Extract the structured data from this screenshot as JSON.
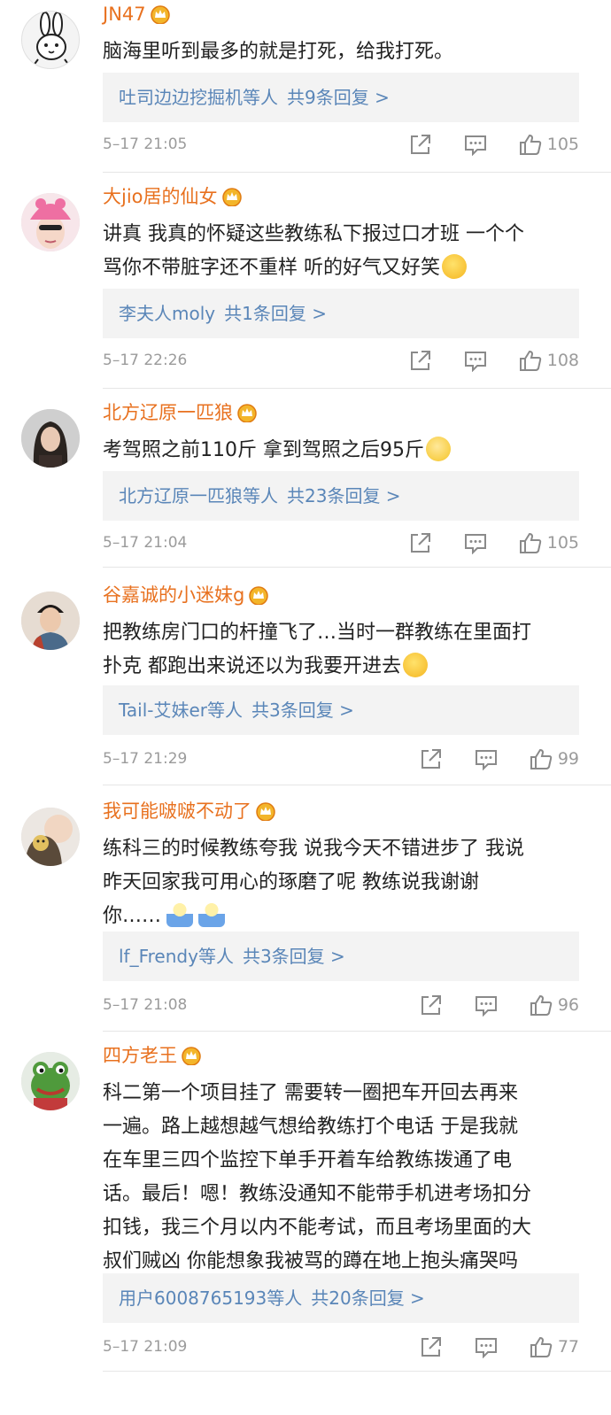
{
  "icons": {
    "crown": "crown-vip-icon",
    "share": "share-icon",
    "reply": "comment-icon",
    "like": "thumbs-up-icon"
  },
  "colors": {
    "username": "#e8711f",
    "reply_link": "#5a86b8",
    "meta": "#9b9b9b",
    "reply_bg": "#f3f3f3"
  },
  "comments": [
    {
      "username": "JN47",
      "text_lines": [
        "脑海里听到最多的就是打死，给我打死。"
      ],
      "reply_names": "吐司边边挖掘机等人",
      "reply_count": "共9条回复 >",
      "time": "5–17 21:05",
      "likes": "105"
    },
    {
      "username": "大jio居的仙女",
      "text_lines": [
        "讲真 我真的怀疑这些教练私下报过口才班 一个个",
        "骂你不带脏字还不重样 听的好气又好笑"
      ],
      "reply_names": "李夫人moly",
      "reply_count": "共1条回复 >",
      "time": "5–17 22:26",
      "likes": "108"
    },
    {
      "username": "北方辽原一匹狼",
      "text_lines": [
        "考驾照之前110斤 拿到驾照之后95斤"
      ],
      "reply_names": "北方辽原一匹狼等人",
      "reply_count": "共23条回复 >",
      "time": "5–17 21:04",
      "likes": "105"
    },
    {
      "username": "谷嘉诚的小迷妹g",
      "text_lines": [
        "把教练房门口的杆撞飞了…当时一群教练在里面打",
        "扑克 都跑出来说还以为我要开进去"
      ],
      "reply_names": "Tail-艾妹er等人",
      "reply_count": "共3条回复 >",
      "time": "5–17 21:29",
      "likes": "99"
    },
    {
      "username": "我可能啵啵不动了",
      "text_lines": [
        "练科三的时候教练夸我 说我今天不错进步了 我说",
        "昨天回家我可用心的琢磨了呢 教练说我谢谢",
        "你……"
      ],
      "reply_names": "lf_Frendy等人",
      "reply_count": "共3条回复 >",
      "time": "5–17 21:08",
      "likes": "96"
    },
    {
      "username": "四方老王",
      "text_lines": [
        "科二第一个项目挂了 需要转一圈把车开回去再来",
        "一遍。路上越想越气想给教练打个电话 于是我就",
        "在车里三四个监控下单手开着车给教练拨通了电",
        "话。最后！嗯！教练没通知不能带手机进考场扣分",
        "扣钱，我三个月以内不能考试，而且考场里面的大",
        "叔们贼凶 你能想象我被骂的蹲在地上抱头痛哭吗"
      ],
      "reply_names": "用户6008765193等人",
      "reply_count": "共20条回复 >",
      "time": "5–17 21:09",
      "likes": "77"
    }
  ]
}
